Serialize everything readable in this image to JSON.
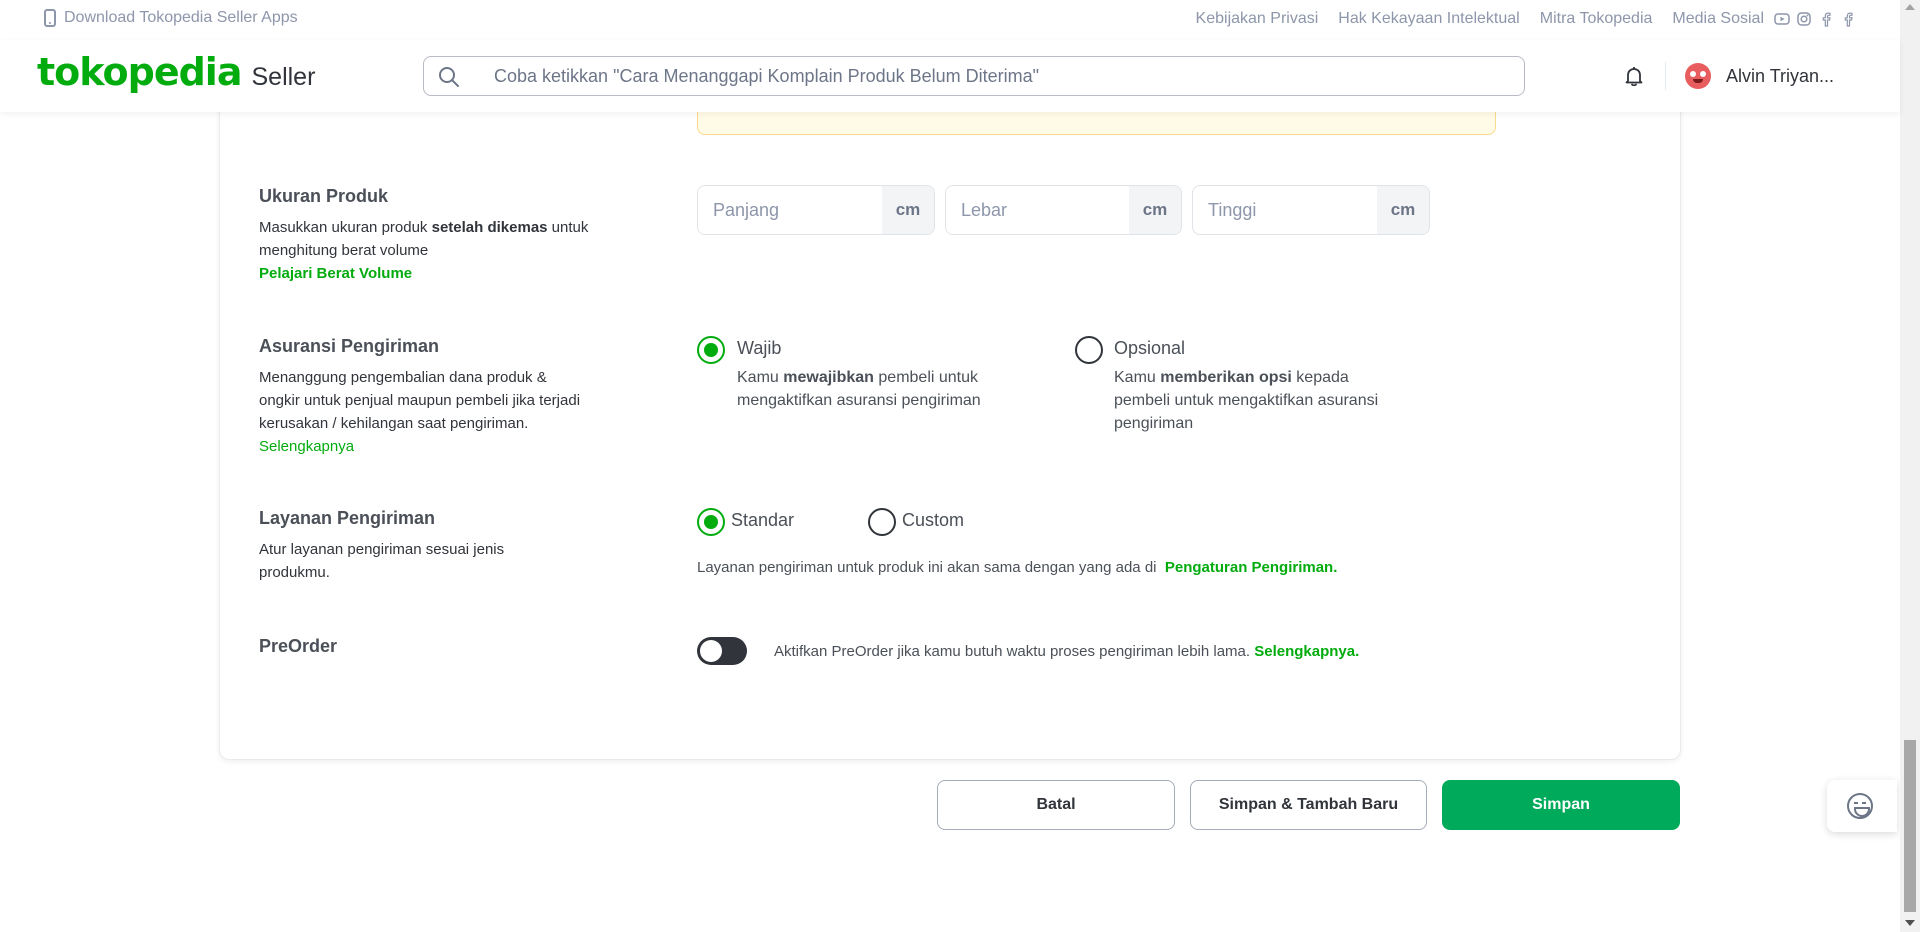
{
  "topbar": {
    "download_app": "Download Tokopedia Seller Apps",
    "links": [
      "Kebijakan Privasi",
      "Hak Kekayaan Intelektual",
      "Mitra Tokopedia",
      "Media Sosial"
    ],
    "social_icons": [
      "youtube-icon",
      "instagram-icon",
      "facebook-icon",
      "facebook-icon"
    ]
  },
  "header": {
    "logo": "tokopedia",
    "logo_suffix": "Seller",
    "search_placeholder": "Coba ketikkan \"Cara Menanggapi Komplain Produk Belum Diterima\"",
    "username": "Alvin Triyan..."
  },
  "ukuran": {
    "title": "Ukuran Produk",
    "desc_1": "Masukkan ukuran produk ",
    "desc_bold": "setelah dikemas",
    "desc_2": " untuk menghitung berat volume",
    "link": "Pelajari Berat Volume",
    "fields": [
      {
        "placeholder": "Panjang",
        "unit": "cm"
      },
      {
        "placeholder": "Lebar",
        "unit": "cm"
      },
      {
        "placeholder": "Tinggi",
        "unit": "cm"
      }
    ]
  },
  "asuransi": {
    "title": "Asuransi Pengiriman",
    "desc": "Menanggung pengembalian dana produk & ongkir untuk penjual maupun pembeli jika terjadi kerusakan / kehilangan saat pengiriman.",
    "link": "Selengkapnya",
    "options": [
      {
        "label": "Wajib",
        "desc_pre": "Kamu ",
        "desc_bold": "mewajibkan",
        "desc_post": " pembeli untuk mengaktifkan asuransi pengiriman",
        "selected": true
      },
      {
        "label": "Opsional",
        "desc_pre": "Kamu ",
        "desc_bold": "memberikan opsi",
        "desc_post": " kepada pembeli untuk mengaktifkan asuransi pengiriman",
        "selected": false
      }
    ]
  },
  "layanan": {
    "title": "Layanan Pengiriman",
    "desc": "Atur layanan pengiriman sesuai jenis produkmu.",
    "options": [
      {
        "label": "Standar",
        "selected": true
      },
      {
        "label": "Custom",
        "selected": false
      }
    ],
    "info": "Layanan pengiriman untuk produk ini akan sama dengan yang ada di",
    "info_link": "Pengaturan Pengiriman."
  },
  "preorder": {
    "title": "PreOrder",
    "enabled": false,
    "info": "Aktifkan PreOrder jika kamu butuh waktu proses pengiriman lebih lama.",
    "info_link": "Selengkapnya."
  },
  "actions": {
    "cancel": "Batal",
    "save_add": "Simpan & Tambah Baru",
    "save": "Simpan"
  },
  "colors": {
    "brand": "#03ac0e",
    "primary_button": "#00aa5b"
  }
}
